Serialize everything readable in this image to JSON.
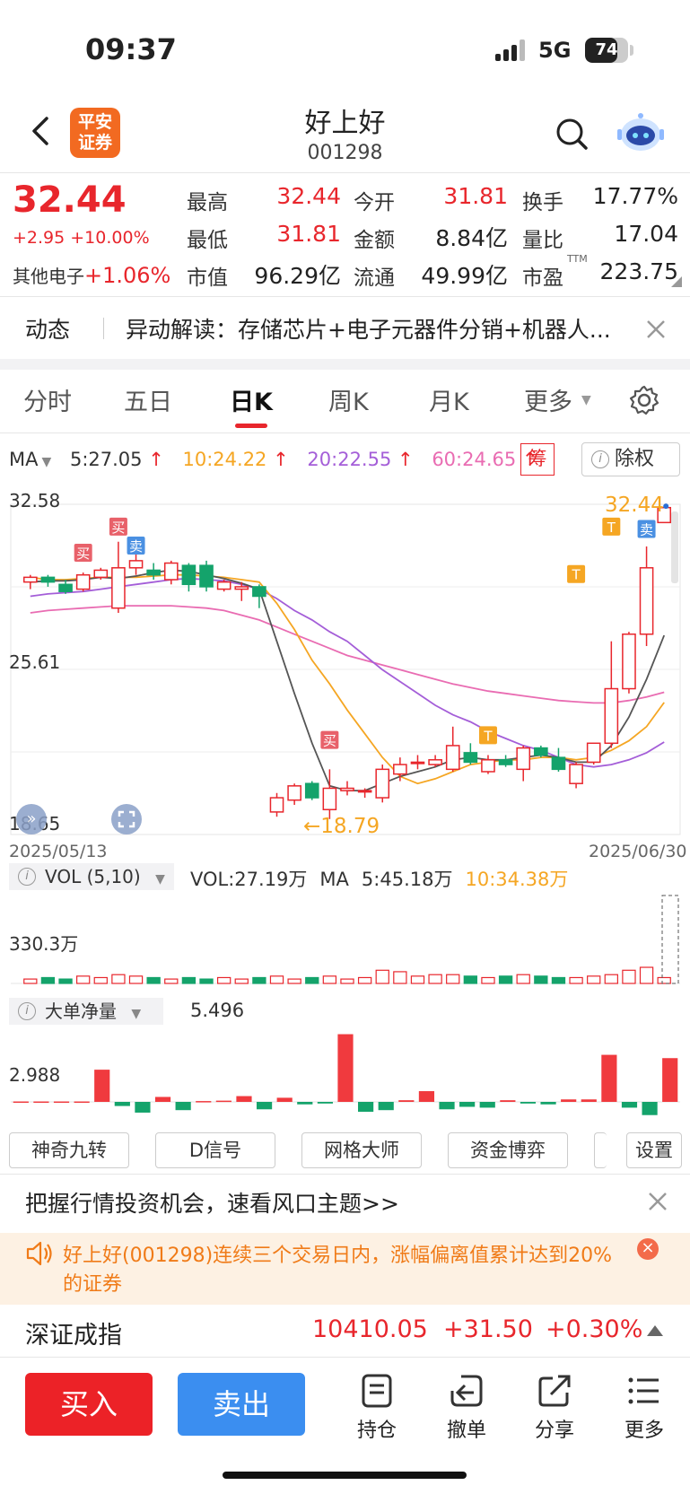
{
  "status_bar": {
    "time": "09:37",
    "network": "5G",
    "battery": "74",
    "battery_level": 0.74
  },
  "header": {
    "logo_line1": "平安",
    "logo_line2": "证券",
    "stock_name": "好上好",
    "stock_code": "001298"
  },
  "quote": {
    "price": "32.44",
    "change": "+2.95 +10.00%",
    "sector_name": "其他电子",
    "sector_change": "+1.06%",
    "fields": [
      {
        "label": "最高",
        "value": "32.44",
        "color": "red"
      },
      {
        "label": "今开",
        "value": "31.81",
        "color": "red"
      },
      {
        "label": "换手",
        "value": "17.77%",
        "color": "black"
      },
      {
        "label": "最低",
        "value": "31.81",
        "color": "red"
      },
      {
        "label": "金额",
        "value": "8.84亿",
        "color": "black"
      },
      {
        "label": "量比",
        "value": "17.04",
        "color": "black"
      },
      {
        "label": "市值",
        "value": "96.29亿",
        "color": "black"
      },
      {
        "label": "流通",
        "value": "49.99亿",
        "color": "black"
      },
      {
        "label": "市盈",
        "value": "223.75",
        "color": "black"
      }
    ],
    "pe_superscript": "TTM"
  },
  "news": {
    "label": "动态",
    "text": "异动解读：存储芯片+电子元器件分销+机器人..."
  },
  "tabs": [
    {
      "label": "分时",
      "active": false
    },
    {
      "label": "五日",
      "active": false
    },
    {
      "label": "日K",
      "active": true
    },
    {
      "label": "周K",
      "active": false
    },
    {
      "label": "月K",
      "active": false
    },
    {
      "label": "更多",
      "active": false
    }
  ],
  "ma_row": {
    "label": "MA",
    "ma5": "5:27.05",
    "ma10": "10:24.22",
    "ma20": "20:22.55",
    "ma60": "60:24.65",
    "chip_button": "筹",
    "exright_button": "除权"
  },
  "chart_data": {
    "type": "candlestick",
    "y_axis_labels": [
      "32.58",
      "25.61",
      "18.65"
    ],
    "ylim": [
      18.65,
      32.58
    ],
    "x_start": "2025/05/13",
    "x_end": "2025/06/30",
    "high_marker": "32.44",
    "low_marker": "18.79",
    "candles": [
      [
        29.3,
        29.6,
        29.0,
        29.5
      ],
      [
        29.5,
        29.6,
        29.1,
        29.3
      ],
      [
        29.2,
        29.4,
        28.8,
        28.9
      ],
      [
        29.0,
        29.7,
        28.9,
        29.6
      ],
      [
        29.5,
        29.9,
        29.4,
        29.8
      ],
      [
        28.2,
        31.0,
        28.0,
        29.9
      ],
      [
        29.9,
        30.8,
        29.6,
        30.2
      ],
      [
        29.8,
        30.1,
        29.4,
        29.6
      ],
      [
        29.4,
        30.2,
        29.2,
        30.1
      ],
      [
        30.0,
        30.1,
        28.9,
        29.2
      ],
      [
        30.0,
        30.2,
        28.9,
        29.1
      ],
      [
        29.0,
        29.4,
        28.9,
        29.3
      ],
      [
        29.0,
        29.3,
        28.5,
        29.1
      ],
      [
        29.1,
        29.2,
        28.2,
        28.7
      ],
      [
        19.6,
        20.4,
        19.4,
        20.2
      ],
      [
        20.1,
        20.8,
        19.9,
        20.7
      ],
      [
        20.8,
        20.9,
        20.1,
        20.2
      ],
      [
        19.7,
        21.4,
        19.3,
        20.6
      ],
      [
        20.5,
        20.9,
        20.3,
        20.6
      ],
      [
        20.5,
        20.6,
        20.2,
        20.5
      ],
      [
        20.2,
        21.6,
        20.0,
        21.4
      ],
      [
        21.2,
        21.9,
        20.9,
        21.6
      ],
      [
        21.7,
        22.0,
        21.4,
        21.7
      ],
      [
        21.6,
        22.0,
        21.5,
        21.8
      ],
      [
        21.4,
        23.2,
        21.3,
        22.4
      ],
      [
        22.1,
        22.5,
        21.6,
        21.7
      ],
      [
        21.3,
        22.0,
        21.2,
        21.8
      ],
      [
        21.8,
        22.0,
        21.5,
        21.6
      ],
      [
        21.4,
        22.4,
        20.9,
        22.3
      ],
      [
        22.3,
        22.4,
        21.9,
        22.0
      ],
      [
        21.9,
        22.3,
        21.3,
        21.4
      ],
      [
        20.8,
        21.7,
        20.6,
        21.6
      ],
      [
        21.7,
        22.5,
        21.6,
        22.5
      ],
      [
        22.5,
        26.8,
        22.3,
        24.8
      ],
      [
        24.8,
        27.2,
        24.6,
        27.1
      ],
      [
        27.1,
        30.8,
        26.6,
        29.9
      ],
      [
        31.81,
        32.44,
        31.81,
        32.44
      ]
    ],
    "ma5": [
      29.3,
      29.35,
      29.35,
      29.4,
      29.5,
      29.45,
      29.55,
      29.7,
      29.8,
      29.75,
      29.6,
      29.45,
      29.25,
      29.0,
      26.8,
      24.6,
      22.5,
      20.7,
      20.5,
      20.5,
      20.8,
      21.1,
      21.3,
      21.5,
      21.8,
      21.9,
      21.8,
      21.8,
      21.9,
      22.0,
      21.9,
      21.7,
      21.7,
      22.4,
      23.6,
      25.2,
      27.05
    ],
    "ma10": [
      29.5,
      29.4,
      29.4,
      29.45,
      29.5,
      29.5,
      29.5,
      29.55,
      29.6,
      29.6,
      29.55,
      29.5,
      29.4,
      29.3,
      28.4,
      27.3,
      26.0,
      25.0,
      23.9,
      22.9,
      21.9,
      21.1,
      20.8,
      21.0,
      21.3,
      21.6,
      21.7,
      21.8,
      21.8,
      21.9,
      21.9,
      21.8,
      21.9,
      22.2,
      22.6,
      23.2,
      24.22
    ],
    "ma20": [
      28.7,
      28.8,
      28.85,
      28.9,
      29.0,
      29.1,
      29.2,
      29.3,
      29.4,
      29.45,
      29.4,
      29.35,
      29.2,
      29.0,
      28.6,
      28.1,
      27.7,
      27.2,
      26.8,
      26.2,
      25.6,
      25.1,
      24.6,
      24.1,
      23.7,
      23.4,
      23.0,
      22.7,
      22.4,
      22.2,
      21.9,
      21.6,
      21.5,
      21.6,
      21.8,
      22.1,
      22.55
    ],
    "ma60": [
      28.0,
      28.1,
      28.15,
      28.2,
      28.25,
      28.3,
      28.3,
      28.3,
      28.3,
      28.25,
      28.2,
      28.1,
      27.9,
      27.7,
      27.4,
      27.1,
      26.8,
      26.5,
      26.2,
      26.0,
      25.8,
      25.6,
      25.4,
      25.2,
      25.0,
      24.85,
      24.7,
      24.6,
      24.5,
      24.4,
      24.3,
      24.25,
      24.2,
      24.2,
      24.3,
      24.45,
      24.65
    ],
    "signals": [
      {
        "label": "买",
        "index": 3,
        "price": 30.5,
        "kind": "buy"
      },
      {
        "label": "买",
        "index": 5,
        "price": 31.6,
        "kind": "buy"
      },
      {
        "label": "卖",
        "index": 6,
        "price": 30.8,
        "kind": "sell"
      },
      {
        "label": "买",
        "index": 17,
        "price": 22.6,
        "kind": "buy"
      },
      {
        "label": "T",
        "index": 26,
        "price": 22.8,
        "kind": "t"
      },
      {
        "label": "T",
        "index": 31,
        "price": 29.6,
        "kind": "t"
      },
      {
        "label": "T",
        "index": 33,
        "price": 31.6,
        "kind": "t"
      },
      {
        "label": "卖",
        "index": 35,
        "price": 31.5,
        "kind": "sell"
      }
    ]
  },
  "volume_panel": {
    "label": "VOL (5,10)",
    "vol": "VOL:27.19万",
    "ma_label": "MA",
    "ma5": "5:45.18万",
    "ma10": "10:34.38万",
    "axis_label": "330.3万",
    "values": [
      3,
      4,
      3,
      5,
      4,
      6,
      5,
      4,
      3,
      4,
      3,
      4,
      3,
      4,
      5,
      3,
      4,
      5,
      3,
      4,
      9,
      8,
      5,
      6,
      6,
      5,
      4,
      5,
      6,
      5,
      4,
      4,
      5,
      6,
      9,
      11,
      4
    ]
  },
  "bigorder_panel": {
    "label": "大单净量",
    "value": "5.496",
    "axis_label": "2.988",
    "values": [
      0.05,
      0.05,
      0.05,
      0.05,
      3.9,
      -0.5,
      -1.3,
      0.6,
      -1.0,
      0.1,
      0.15,
      0.7,
      -0.9,
      0.5,
      -0.3,
      -0.2,
      8.2,
      -1.2,
      -1.0,
      0.2,
      1.3,
      -0.9,
      -0.6,
      -0.7,
      0.2,
      -0.2,
      -0.3,
      0.3,
      0.3,
      5.7,
      -0.7,
      -1.6,
      5.3
    ]
  },
  "indicator_buttons": [
    "神奇九转",
    "D信号",
    "网格大师",
    "资金博弈",
    "设置"
  ],
  "promo": {
    "text": "把握行情投资机会，速看风口主题>>"
  },
  "alert": {
    "text": "好上好(001298)连续三个交易日内，涨幅偏离值累计达到20%的证券"
  },
  "index_bar": {
    "name": "深证成指",
    "value": "10410.05",
    "change": "+31.50",
    "pct": "+0.30%"
  },
  "bottom_nav": {
    "buy": "买入",
    "sell": "卖出",
    "items": [
      {
        "label": "持仓",
        "icon": "doc-icon"
      },
      {
        "label": "撤单",
        "icon": "undo-icon"
      },
      {
        "label": "分享",
        "icon": "share-icon"
      },
      {
        "label": "更多",
        "icon": "menu-icon"
      }
    ]
  },
  "colors": {
    "up": "#e8262c",
    "down": "#14a36b",
    "ma5": "#555555",
    "ma10": "#f5a623",
    "ma20": "#a45ed8",
    "ma60": "#e96cb2",
    "buy": "#ec2227",
    "sell": "#3b8ef0"
  }
}
